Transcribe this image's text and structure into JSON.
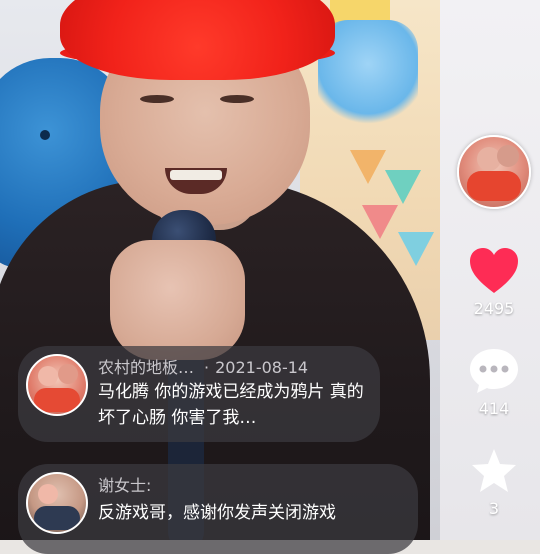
{
  "rail": {
    "creator_avatar_icon": "avatar-icon",
    "like": {
      "icon": "heart-icon",
      "color": "#fe2c55",
      "count": "2495"
    },
    "comment": {
      "icon": "chat-bubble-icon",
      "count": "414"
    },
    "favorite": {
      "icon": "star-icon",
      "count": "3"
    }
  },
  "comments": [
    {
      "username": "农村的地板…",
      "separator": "·",
      "date": "2021-08-14",
      "text": "马化腾 你的游戏已经成为鸦片 真的坏了心肠 你害了我…"
    },
    {
      "username": "谢女士:",
      "text": "反游戏哥，感谢你发声关闭游戏"
    }
  ]
}
